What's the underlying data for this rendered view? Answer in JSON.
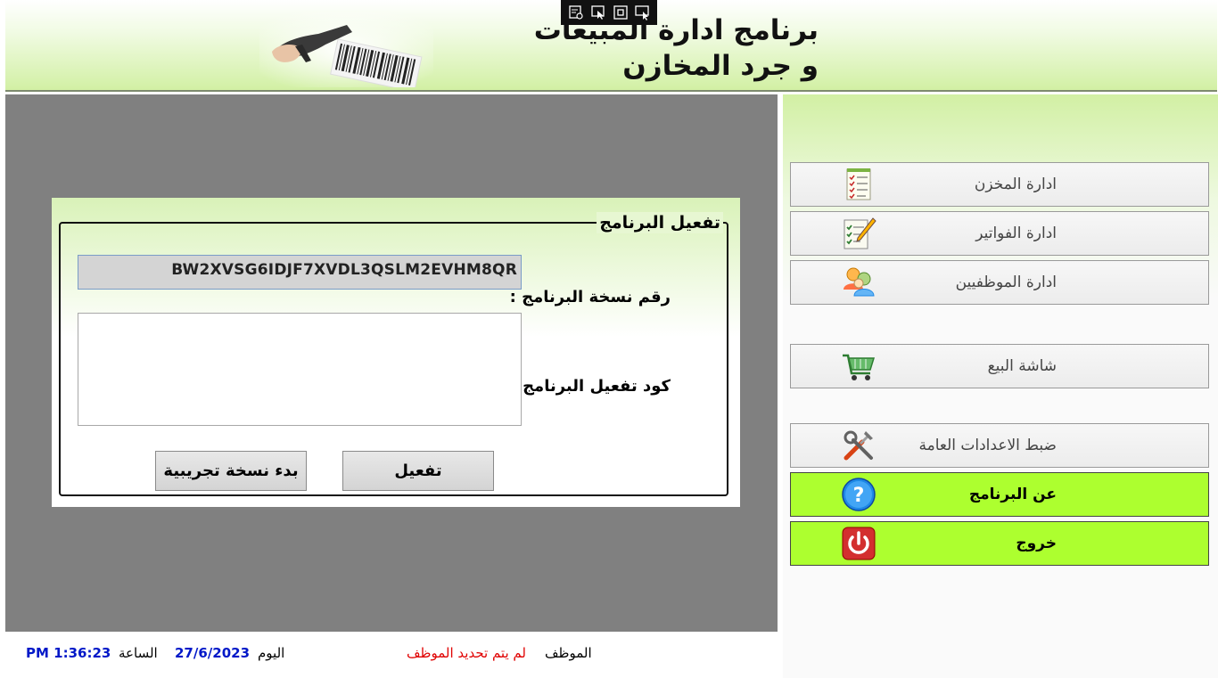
{
  "header": {
    "title_line1": "برنامج ادارة المبيعات",
    "title_line2": "و جرد المخازن",
    "image_icon": "barcode-scanner-icon"
  },
  "top_toolbar": {
    "icons": [
      "settings-window-icon",
      "pointer-icon",
      "fit-screen-icon",
      "remote-control-icon"
    ]
  },
  "activation": {
    "group_title": "تفعيل البرنامج",
    "serial_label": "رقم نسخة البرنامج :",
    "serial_value": "BW2XVSG6IDJF7XVDL3QSLM2EVHM8QR",
    "code_label": "كود تفعيل البرنامج :",
    "code_value": "",
    "activate_button": "تفعيل",
    "trial_button": "بدء نسخة تجريبية"
  },
  "menu": {
    "items": [
      {
        "label": "ادارة المخزن",
        "icon": "checklist-icon"
      },
      {
        "label": "ادارة الفواتير",
        "icon": "edit-document-icon"
      },
      {
        "label": "ادارة الموظفيين",
        "icon": "users-icon"
      },
      {
        "label": "شاشة البيع",
        "icon": "shopping-cart-icon"
      },
      {
        "label": "ضبط الاعدادات العامة",
        "icon": "tools-icon"
      },
      {
        "label": "عن البرنامج",
        "icon": "help-icon"
      },
      {
        "label": "خروج",
        "icon": "power-icon"
      }
    ],
    "highlight_color": "#adff2f"
  },
  "status": {
    "employee_label": "الموظف",
    "employee_value": "لم يتم تحديد الموظف",
    "date_label": "اليوم",
    "date_value": "27/6/2023",
    "time_label": "الساعة",
    "time_value": "PM 1:36:23"
  },
  "colors": {
    "panel_gray": "#808080",
    "header_green": "#d2f0a4",
    "status_blue": "#0018c8",
    "status_red": "#e00000"
  }
}
